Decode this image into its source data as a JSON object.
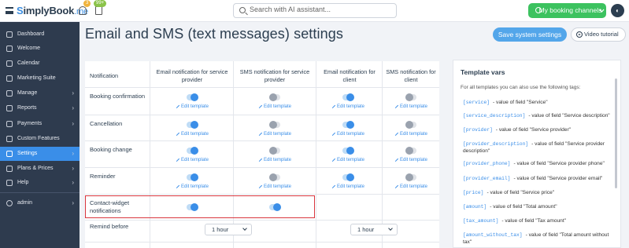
{
  "topbar": {
    "logo_s": "S",
    "logo_text": "implyBook",
    "logo_me": ".me",
    "badge_notifications": "3",
    "badge_tasks": "99+",
    "search_placeholder": "Search with AI assistant...",
    "channels_label": "My booking channels"
  },
  "sidebar": {
    "items": [
      {
        "label": "Dashboard",
        "icon": "dashboard-icon"
      },
      {
        "label": "Welcome",
        "icon": "rocket-icon"
      },
      {
        "label": "Calendar",
        "icon": "calendar-icon"
      },
      {
        "label": "Marketing Suite",
        "icon": "megaphone-icon"
      },
      {
        "label": "Manage",
        "icon": "manage-icon"
      },
      {
        "label": "Reports",
        "icon": "reports-icon"
      },
      {
        "label": "Payments",
        "icon": "payments-icon"
      },
      {
        "label": "Custom Features",
        "icon": "puzzle-icon"
      },
      {
        "label": "Settings",
        "icon": "gear-icon"
      },
      {
        "label": "Plans & Prices",
        "icon": "cart-icon"
      },
      {
        "label": "Help",
        "icon": "help-icon"
      },
      {
        "label": "admin",
        "icon": "user-icon"
      }
    ]
  },
  "header": {
    "title": "Email and SMS (text messages) settings",
    "save_label": "Save system settings",
    "video_label": "Video tutorial"
  },
  "table": {
    "headers": [
      "Notification",
      "Email notification for service provider",
      "SMS notification for service provider",
      "Email notification for client",
      "SMS notification for client"
    ],
    "edit_label": "Edit template",
    "rows": [
      {
        "label": "Booking confirmation",
        "toggles": [
          true,
          false,
          true,
          false
        ]
      },
      {
        "label": "Cancellation",
        "toggles": [
          true,
          false,
          true,
          false
        ]
      },
      {
        "label": "Booking change",
        "toggles": [
          true,
          false,
          true,
          false
        ]
      },
      {
        "label": "Reminder",
        "toggles": [
          true,
          false,
          true,
          false
        ]
      }
    ],
    "widget_row": {
      "label": "Contact-widget notifications",
      "toggles": [
        true,
        true
      ]
    },
    "remind_row": {
      "label": "Remind before",
      "provider_value": "1 hour",
      "client_value": "1 hour"
    }
  },
  "vars": {
    "title": "Template vars",
    "intro": "For all templates you can also use the following tags:",
    "items": [
      {
        "tag": "[service]",
        "desc": "- value of field \"Service\""
      },
      {
        "tag": "[service_description]",
        "desc": "- value of field \"Service description\""
      },
      {
        "tag": "[provider]",
        "desc": "- value of field \"Service provider\""
      },
      {
        "tag": "[provider_description]",
        "desc": "- value of field \"Service provider description\""
      },
      {
        "tag": "[provider_phone]",
        "desc": "- value of field \"Service provider phone\""
      },
      {
        "tag": "[provider_email]",
        "desc": "- value of field \"Service provider email\""
      },
      {
        "tag": "[price]",
        "desc": "- value of field \"Service price\""
      },
      {
        "tag": "[amount]",
        "desc": "- value of field \"Total amount\""
      },
      {
        "tag": "[tax_amount]",
        "desc": "- value of field \"Tax amount\""
      },
      {
        "tag": "[amount_without_tax]",
        "desc": "- value of field \"Total amount without tax\""
      }
    ]
  },
  "colors": {
    "accent": "#3a8ee8",
    "sidebar": "#2e3b4e",
    "channels": "#3cc25f",
    "highlight": "#d9363e"
  }
}
